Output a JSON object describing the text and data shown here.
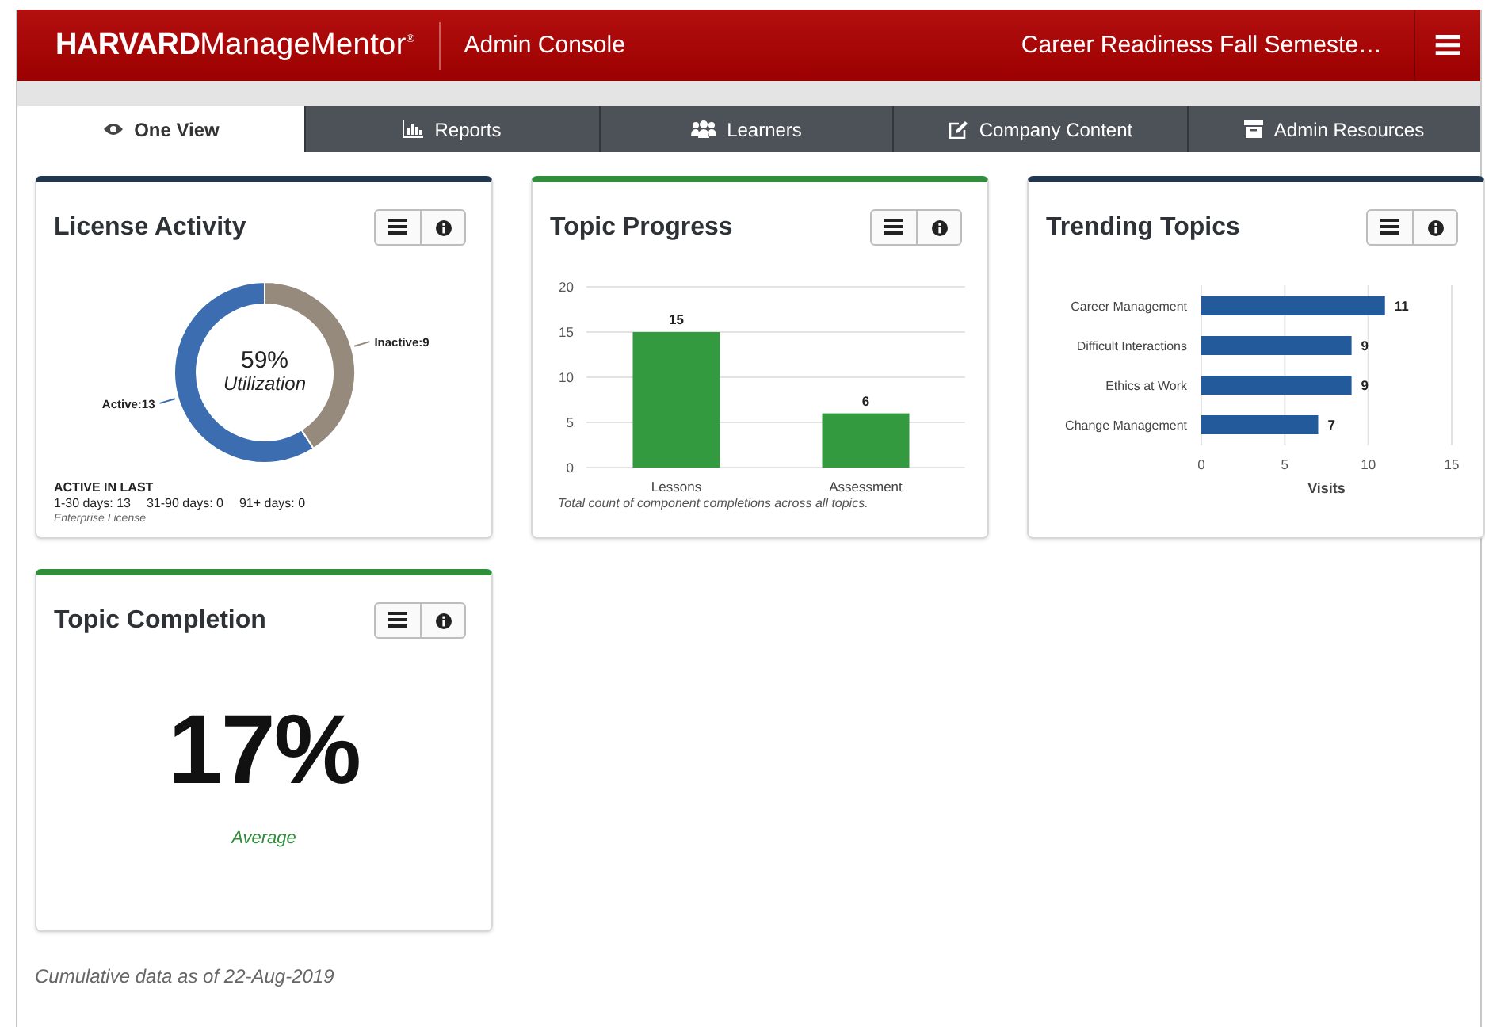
{
  "header": {
    "logo": "**HARVARD**ManageMentor$^{®}$",
    "app_title": "Admin Console",
    "program": "Career Readiness Fall Semeste…"
  },
  "tabs": [
    {
      "label": "One View",
      "selected": true
    },
    {
      "label": "Reports",
      "selected": false
    },
    {
      "label": "Learners",
      "selected": false
    },
    {
      "label": "Company Content",
      "selected": false
    },
    {
      "label": "Admin Resources",
      "selected": false
    }
  ],
  "cards": [
    {
      "kind": "donut",
      "title": "License Activity",
      "color": "#22364f",
      "center_value": "59%",
      "center_label": "Utilization",
      "chart_data": {
        "type": "donut",
        "categories": [
          "Active:13",
          "Inactive:9"
        ],
        "values": [
          13,
          9
        ],
        "colors": [
          "#3b6db0",
          "#968a7c"
        ]
      },
      "active_heading": "ACTIVE IN LAST",
      "active_stats": [
        "1-30 days: 13",
        "31-90 days: 0",
        "91+ days: 0"
      ],
      "note": "Enterprise License"
    },
    {
      "kind": "bar",
      "title": "Topic Progress",
      "color": "#2f8f3c",
      "chart_data": {
        "type": "bar",
        "categories": [
          "Lessons",
          "Assessment"
        ],
        "series": [
          {
            "color": "#339a3f",
            "values": [
              15,
              6
            ]
          }
        ],
        "yticks": [
          0,
          5,
          10,
          15,
          20
        ],
        "ylim": [
          0,
          20
        ],
        "grid": true,
        "data_labels": true
      },
      "caption": "Total count of component completions across all topics."
    },
    {
      "kind": "hbar",
      "title": "Trending Topics",
      "color": "#22364f",
      "chart_data": {
        "type": "bar",
        "orientation": "horizontal",
        "categories": [
          "Career Management",
          "Difficult Interactions",
          "Ethics at Work",
          "Change Management"
        ],
        "series": [
          {
            "color": "#235a9c",
            "values": [
              11,
              9,
              9,
              7
            ]
          }
        ],
        "xticks": [
          0,
          5,
          10,
          15
        ],
        "xlim": [
          0,
          15
        ],
        "xlabel": "Visits",
        "grid": true,
        "data_labels": true
      }
    },
    {
      "kind": "stat",
      "title": "Topic Completion",
      "color": "#2f8f3c",
      "value": "17%",
      "label": "Average"
    }
  ],
  "footer": "Cumulative data as of 22-Aug-2019"
}
